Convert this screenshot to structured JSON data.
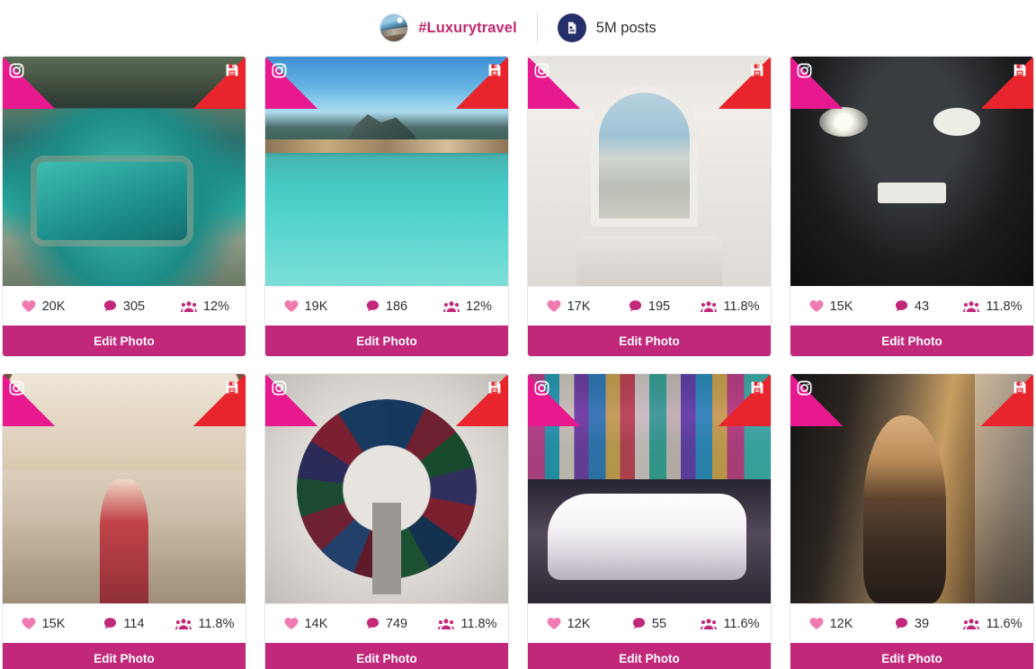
{
  "header": {
    "avatar_icon": "hashtag-avatar-photo",
    "hashtag": "#Luxurytravel",
    "posts_icon": "document-post-icon",
    "posts_count": "5M posts"
  },
  "theme": {
    "pink": "#c2287a",
    "hashtag_pink": "#c2286f",
    "corner_pink": "#e8188f",
    "corner_red": "#e8252c",
    "navy": "#25306b",
    "heart_pink": "#ef7bb0",
    "stat_text": "#2c3036"
  },
  "icons": {
    "instagram": "instagram-icon",
    "save": "save-icon",
    "heart": "heart-icon",
    "comment": "comment-icon",
    "engagement": "people-icon"
  },
  "cards": [
    {
      "scene": "sc-overwater",
      "photo_name": "overwater-villa-pool-photo",
      "likes": "20K",
      "comments": "305",
      "engagement": "12%",
      "edit_label": "Edit Photo"
    },
    {
      "scene": "sc-lagoon",
      "photo_name": "tropical-lagoon-photo",
      "likes": "19K",
      "comments": "186",
      "engagement": "12%",
      "edit_label": "Edit Photo"
    },
    {
      "scene": "sc-bathroom",
      "photo_name": "bathroom-sea-view-photo",
      "likes": "17K",
      "comments": "195",
      "engagement": "11.8%",
      "edit_label": "Edit Photo"
    },
    {
      "scene": "sc-porsche",
      "photo_name": "black-sports-car-photo",
      "likes": "15K",
      "comments": "43",
      "engagement": "11.8%",
      "edit_label": "Edit Photo"
    },
    {
      "scene": "sc-chapel",
      "photo_name": "woman-in-lodge-photo",
      "likes": "15K",
      "comments": "114",
      "engagement": "11.8%",
      "edit_label": "Edit Photo"
    },
    {
      "scene": "sc-passports",
      "photo_name": "passports-circle-photo",
      "likes": "14K",
      "comments": "749",
      "engagement": "11.8%",
      "edit_label": "Edit Photo"
    },
    {
      "scene": "sc-timessq",
      "photo_name": "white-supercar-times-square-photo",
      "likes": "12K",
      "comments": "55",
      "engagement": "11.6%",
      "edit_label": "Edit Photo"
    },
    {
      "scene": "sc-woman",
      "photo_name": "woman-in-sequin-jacket-photo",
      "likes": "12K",
      "comments": "39",
      "engagement": "11.6%",
      "edit_label": "Edit Photo"
    }
  ]
}
